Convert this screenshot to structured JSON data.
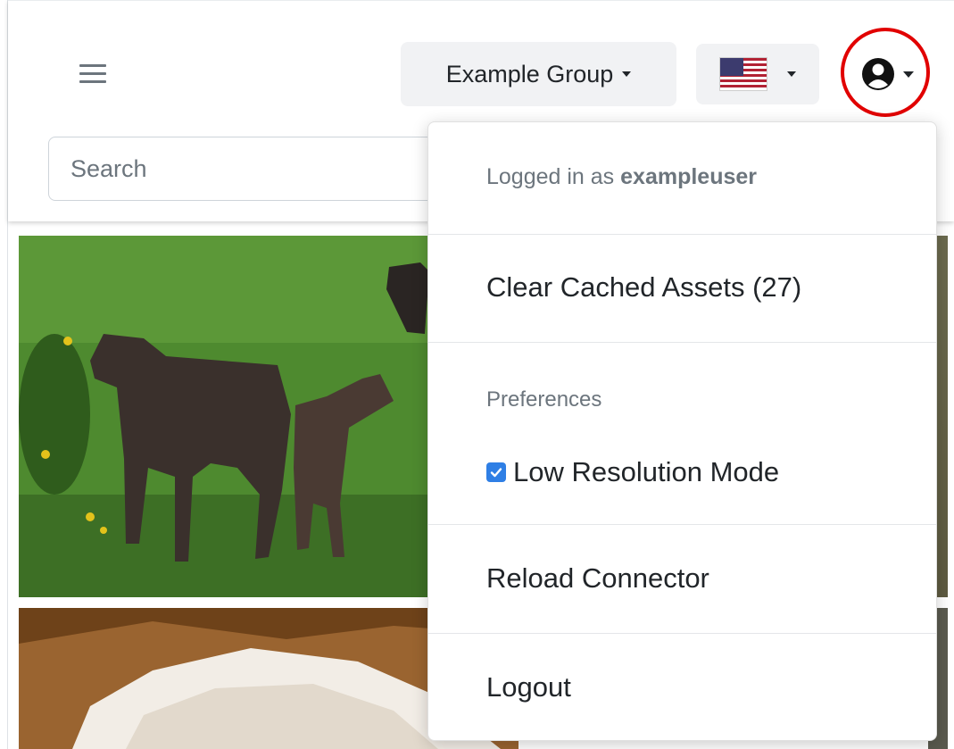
{
  "header": {
    "group_label": "Example Group",
    "language_flag": "us-flag-icon",
    "search_placeholder": "Search"
  },
  "user_menu": {
    "logged_in_prefix": "Logged in as",
    "username": "exampleuser",
    "clear_cache_label": "Clear Cached Assets (27)",
    "preferences_label": "Preferences",
    "low_res_label": "Low Resolution Mode",
    "low_res_checked": true,
    "reload_label": "Reload Connector",
    "logout_label": "Logout"
  },
  "colors": {
    "highlight_ring": "#e10000",
    "checkbox_accent": "#2f7fe5"
  }
}
